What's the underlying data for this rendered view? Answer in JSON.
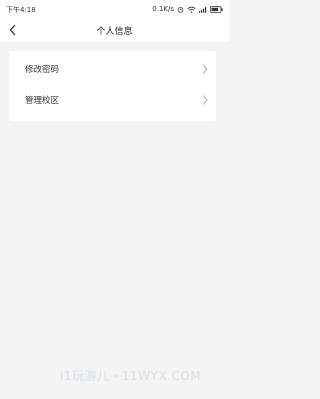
{
  "statusbar": {
    "time": "下午4:18",
    "net_speed": "0.1K/s"
  },
  "header": {
    "title": "个人信息"
  },
  "menu": [
    {
      "label": "修改密码"
    },
    {
      "label": "管理校区"
    }
  ],
  "watermark": "i1玩游儿・11WYX.COM",
  "icons": {
    "back": "chevron-left-icon",
    "row_arrow": "chevron-right-icon",
    "wifi": "wifi-icon",
    "signal": "signal-icon",
    "battery": "battery-icon",
    "alarm": "alarm-icon"
  }
}
